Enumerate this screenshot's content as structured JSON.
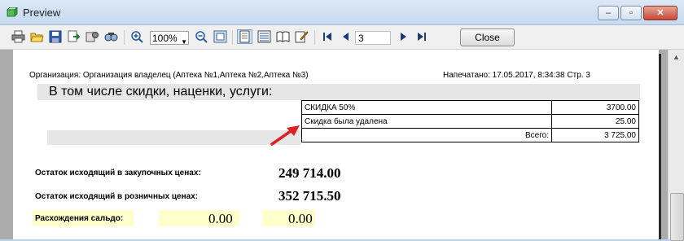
{
  "window": {
    "title": "Preview"
  },
  "toolbar": {
    "zoom": "100%",
    "page": "3",
    "close_label": "Close"
  },
  "report": {
    "org": "Организация: Организация владелец (Аптека №1,Аптека №2,Аптека №3)",
    "printed": "Напечатано: 17.05.2017, 8:34:38 Стр. 3",
    "section_title": "В том числе скидки, наценки, услуги:",
    "discounts": [
      {
        "name": "СКИДКА 50%",
        "value": "3700.00"
      },
      {
        "name": "Скидка была удалена",
        "value": "25.00"
      }
    ],
    "total_label": "Всего:",
    "total_value": "3 725.00",
    "purchase_label": "Остаток исходящий в закупочных ценах:",
    "purchase_value": "249 714.00",
    "retail_label": "Остаток исходящий в розничных ценах:",
    "retail_value": "352 715.50",
    "diff_label": "Расхождения сальдо:",
    "diff_value1": "0.00",
    "diff_value2": "0.00"
  },
  "colors": {
    "arrow": "#e02020",
    "highlight": "#ffffcc"
  }
}
